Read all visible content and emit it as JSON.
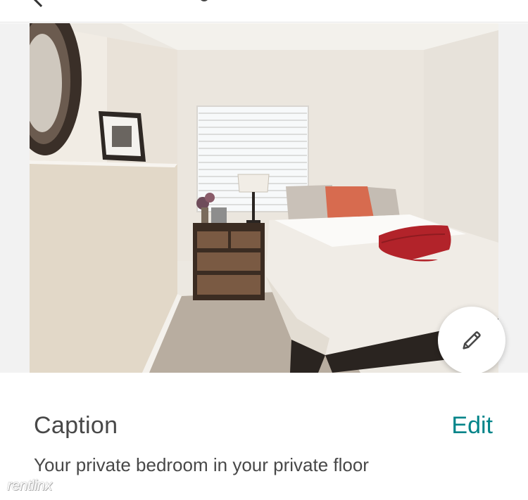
{
  "caption": {
    "title": "Caption",
    "edit_label": "Edit",
    "text": "Your private bedroom in your private floor"
  },
  "photo": {
    "alt": "Bedroom with bed, nightstand, lamp and window",
    "edit_icon": "pencil-icon"
  },
  "watermark": "rentlinx",
  "colors": {
    "accent": "#008489",
    "text": "#484848",
    "background": "#ffffff"
  }
}
